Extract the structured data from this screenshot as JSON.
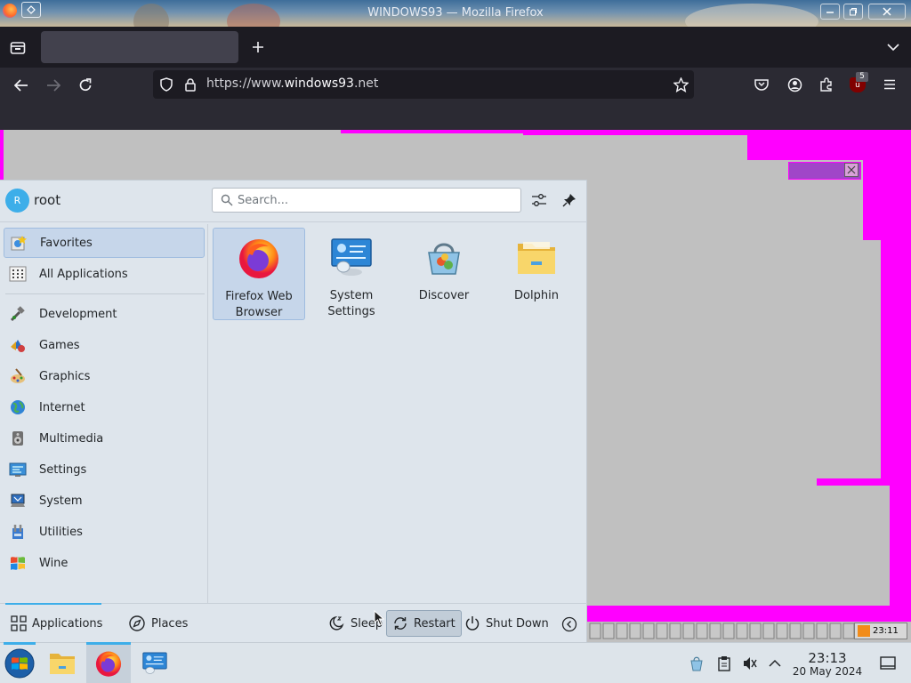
{
  "window": {
    "title": "WINDOWS93 — Mozilla Firefox"
  },
  "browser": {
    "url_prefix": "https://www.",
    "url_domain": "windows93",
    "url_suffix": ".net",
    "extension_badge": "5"
  },
  "desktop_site": {
    "clock": "23:11"
  },
  "launcher": {
    "user": {
      "name": "root",
      "initial": "R"
    },
    "search": {
      "placeholder": "Search..."
    },
    "top_categories": [
      {
        "label": "Favorites",
        "icon": "favorites-icon",
        "selected": true
      },
      {
        "label": "All Applications",
        "icon": "all-applications-icon",
        "selected": false
      }
    ],
    "categories": [
      {
        "label": "Development",
        "icon": "development-icon"
      },
      {
        "label": "Games",
        "icon": "games-icon"
      },
      {
        "label": "Graphics",
        "icon": "graphics-icon"
      },
      {
        "label": "Internet",
        "icon": "internet-icon"
      },
      {
        "label": "Multimedia",
        "icon": "multimedia-icon"
      },
      {
        "label": "Settings",
        "icon": "settings-icon"
      },
      {
        "label": "System",
        "icon": "system-icon"
      },
      {
        "label": "Utilities",
        "icon": "utilities-icon"
      },
      {
        "label": "Wine",
        "icon": "wine-icon"
      }
    ],
    "favorites": [
      {
        "label": "Firefox Web Browser",
        "icon": "firefox-icon",
        "selected": true
      },
      {
        "label": "System Settings",
        "icon": "system-settings-icon",
        "selected": false
      },
      {
        "label": "Discover",
        "icon": "discover-icon",
        "selected": false
      },
      {
        "label": "Dolphin",
        "icon": "dolphin-folder-icon",
        "selected": false
      }
    ],
    "footer": {
      "applications": "Applications",
      "places": "Places",
      "sleep": "Sleep",
      "restart": "Restart",
      "shutdown": "Shut Down"
    }
  },
  "taskbar": {
    "time": "23:13",
    "date": "20 May 2024"
  },
  "colors": {
    "accent": "#3daee9",
    "selection": "#c6d6ea",
    "firefox_dark": "#2b2a33",
    "site_magenta": "#ff00ff"
  }
}
